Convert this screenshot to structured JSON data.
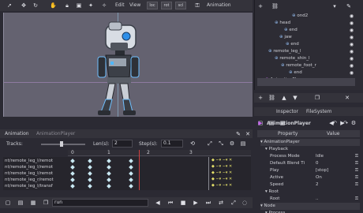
{
  "toolbar": {
    "menus": [
      "Edit",
      "View"
    ],
    "mode_buttons": [
      "loc",
      "rot",
      "scl"
    ],
    "animation_label": "Animation"
  },
  "viewport": {
    "bg": "#646270"
  },
  "anim_panel": {
    "tabs": [
      "Animation",
      "AnimationPlayer"
    ],
    "tracks_label": "Tracks:",
    "len_label": "Len(s):",
    "len_value": "2",
    "step_label": "Step(s):",
    "step_value": "0.1",
    "ruler": [
      "0",
      "1",
      "2",
      "3"
    ],
    "tracks": [
      "nt/remote_leg_l/remot",
      "nt/remote_leg_l/remot",
      "nt/remote_leg_l/remot",
      "nt/remote_leg_r/remot",
      "nt/remote_leg_l/transf"
    ],
    "anim_name": "run",
    "playhead_color": "#d04040"
  },
  "scene_tree": {
    "items": [
      {
        "label": "ond2",
        "indent": 44
      },
      {
        "label": "head",
        "indent": 22
      },
      {
        "label": "end",
        "indent": 34
      },
      {
        "label": "jaw",
        "indent": 28
      },
      {
        "label": "end",
        "indent": 36
      },
      {
        "label": "remote_leg_l",
        "indent": 14
      },
      {
        "label": "remote_shin_l",
        "indent": 22
      },
      {
        "label": "remote_foot_r",
        "indent": 30
      },
      {
        "label": "end",
        "indent": 40
      },
      {
        "label": "AnimationPlayer",
        "indent": 10
      }
    ]
  },
  "inspector": {
    "tabs": [
      "Inspector",
      "FileSystem"
    ],
    "object_name": "AnimationPlayer",
    "col_property": "Property",
    "col_value": "Value",
    "rows": [
      {
        "name": "AnimationPlayer",
        "value": "",
        "level": 0,
        "section": true
      },
      {
        "name": "Playback",
        "value": "",
        "level": 1,
        "section": true
      },
      {
        "name": "Process Mode",
        "value": "Idle",
        "level": 2,
        "section": false
      },
      {
        "name": "Default Blend Ti",
        "value": "0",
        "level": 2,
        "section": false
      },
      {
        "name": "Play",
        "value": "[stop]",
        "level": 2,
        "section": false
      },
      {
        "name": "Active",
        "value": "On",
        "level": 2,
        "section": false
      },
      {
        "name": "Speed",
        "value": "2",
        "level": 2,
        "section": false
      },
      {
        "name": "Root",
        "value": "",
        "level": 1,
        "section": true
      },
      {
        "name": "Root",
        "value": "..",
        "level": 2,
        "section": false
      },
      {
        "name": "Node",
        "value": "",
        "level": 0,
        "section": true
      },
      {
        "name": "Process",
        "value": "",
        "level": 1,
        "section": true
      }
    ]
  }
}
